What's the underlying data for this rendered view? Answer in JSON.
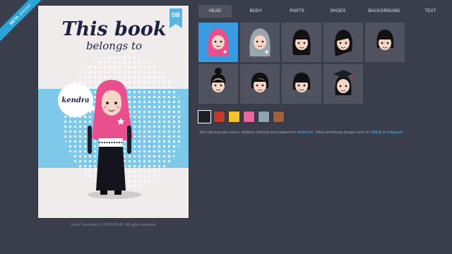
{
  "ribbon": {
    "strong": "BETA",
    "soft": "preview"
  },
  "preview": {
    "title_line1": "This book",
    "title_line2": "belongs to",
    "badge_text": "DB",
    "name": "kendra"
  },
  "tabs": [
    {
      "label": "HEAD",
      "active": true
    },
    {
      "label": "BODY",
      "active": false
    },
    {
      "label": "PANTS",
      "active": false
    },
    {
      "label": "SHOES",
      "active": false
    },
    {
      "label": "BACKGROUND",
      "active": false
    },
    {
      "label": "TEXT",
      "active": false
    }
  ],
  "thumbnails": [
    {
      "name": "head-pink-hijab",
      "selected": true
    },
    {
      "name": "head-grey-hijab",
      "selected": false
    },
    {
      "name": "head-long-hair",
      "selected": false
    },
    {
      "name": "head-side-hair",
      "selected": false
    },
    {
      "name": "head-bob-hair",
      "selected": false
    },
    {
      "name": "head-bun-hair",
      "selected": false
    },
    {
      "name": "head-short-hair",
      "selected": false
    },
    {
      "name": "head-bangs-hair",
      "selected": false
    },
    {
      "name": "head-graduation-cap",
      "selected": false
    }
  ],
  "swatches": [
    {
      "color": "#1c1f2b",
      "selected": true
    },
    {
      "color": "#c0392b",
      "selected": false
    },
    {
      "color": "#f1c232",
      "selected": false
    },
    {
      "color": "#e8669c",
      "selected": false
    },
    {
      "color": "#8fa3b3",
      "selected": false
    },
    {
      "color": "#a0623c",
      "selected": false
    }
  ],
  "note": {
    "prefix": "Jika ada bug atau saran, silahkan hubungi kami pada form ",
    "form_link": "berikut ini",
    "middle": ". Tetap terhubung dengan kami di ",
    "line_link": "LINE@",
    "amp": " & ",
    "ig_link": "instagram",
    "suffix": "."
  },
  "footer": "Cover Generator © 2016 PIN.ID. All rights reserved."
}
